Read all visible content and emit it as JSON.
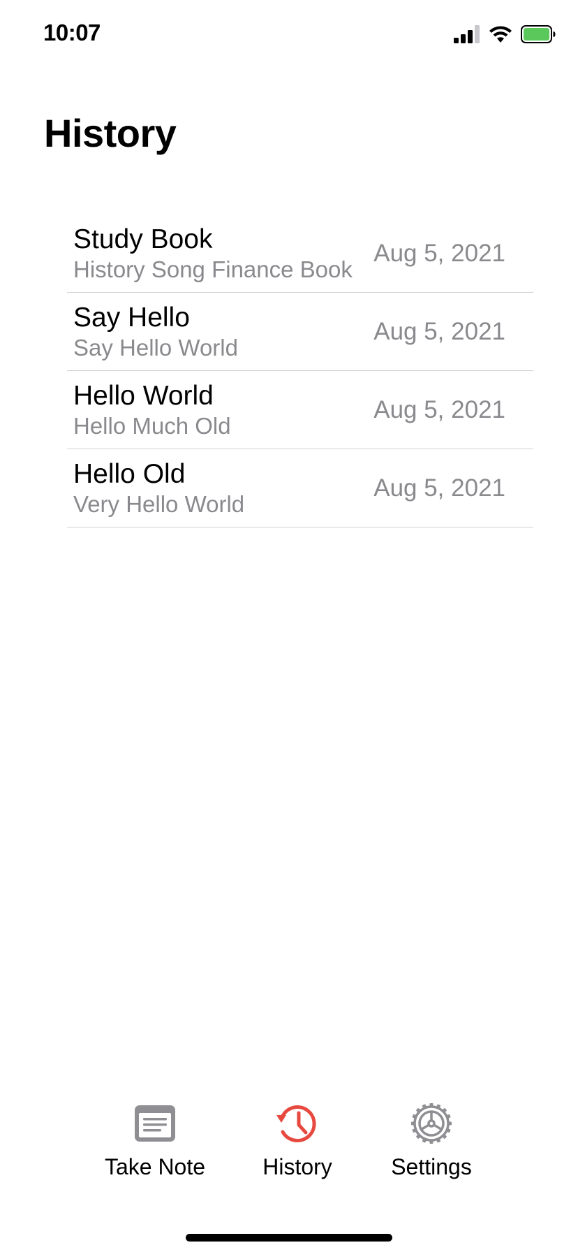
{
  "status_bar": {
    "time": "10:07",
    "icons": [
      "cellular-signal-icon",
      "wifi-icon",
      "battery-icon"
    ],
    "battery_color": "#5ac85a"
  },
  "page": {
    "title": "History"
  },
  "history": [
    {
      "title": "Study Book",
      "subtitle": "History Song Finance Book",
      "date": "Aug 5, 2021"
    },
    {
      "title": "Say Hello",
      "subtitle": "Say Hello World",
      "date": "Aug 5, 2021"
    },
    {
      "title": "Hello World",
      "subtitle": "Hello Much Old",
      "date": "Aug 5, 2021"
    },
    {
      "title": "Hello Old",
      "subtitle": "Very Hello World",
      "date": "Aug 5, 2021"
    }
  ],
  "tab_bar": {
    "active_color": "#e8493f",
    "inactive_color": "#8e8e93",
    "tabs": [
      {
        "label": "Take Note",
        "icon": "note-icon",
        "active": false
      },
      {
        "label": "History",
        "icon": "history-clock-icon",
        "active": true
      },
      {
        "label": "Settings",
        "icon": "gear-icon",
        "active": false
      }
    ]
  }
}
